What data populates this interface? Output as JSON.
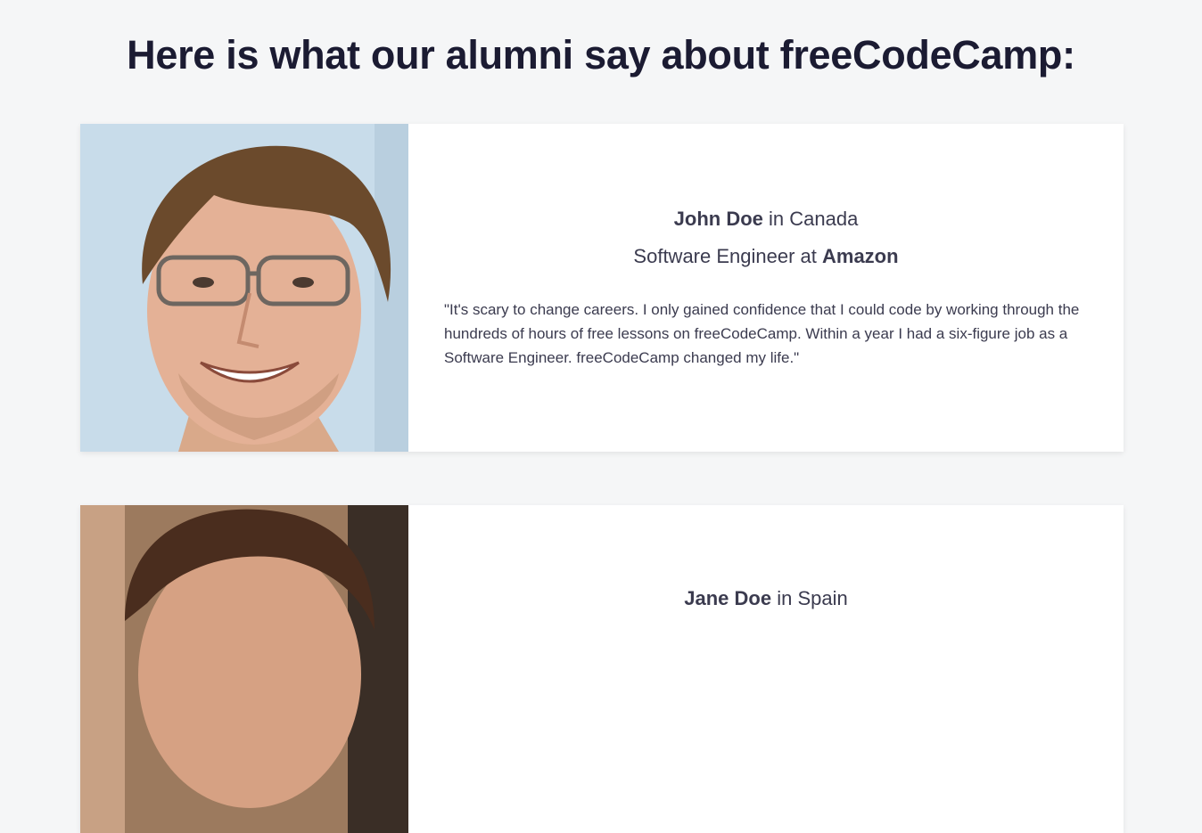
{
  "section": {
    "heading": "Here is what our alumni say about freeCodeCamp:"
  },
  "testimonials": [
    {
      "name": "John Doe",
      "location_prefix": " in ",
      "location": "Canada",
      "role_prefix": "Software Engineer at ",
      "company": "Amazon",
      "quote": "\"It's scary to change careers. I only gained confidence that I could code by working through the hundreds of hours of free lessons on freeCodeCamp. Within a year I had a six-figure job as a Software Engineer. freeCodeCamp changed my life.\""
    },
    {
      "name": "Jane Doe",
      "location_prefix": " in ",
      "location": "Spain"
    }
  ],
  "colors": {
    "background": "#f5f6f7",
    "card": "#ffffff",
    "heading": "#1b1b32",
    "text": "#3b3b4f"
  }
}
